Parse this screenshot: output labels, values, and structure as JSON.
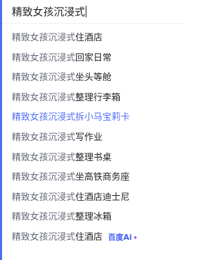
{
  "search": {
    "query": "精致女孩沉浸式"
  },
  "suggestions": [
    {
      "prefix": "精致女孩沉浸式",
      "suffix": "住酒店"
    },
    {
      "prefix": "精致女孩沉浸式",
      "suffix": "回家日常"
    },
    {
      "prefix": "精致女孩沉浸式",
      "suffix": "坐头等舱"
    },
    {
      "prefix": "精致女孩沉浸式",
      "suffix": "整理行李箱"
    },
    {
      "prefix": "精致女孩沉浸式",
      "suffix": "拆小马宝莉卡"
    },
    {
      "prefix": "精致女孩沉浸式",
      "suffix": "写作业"
    },
    {
      "prefix": "精致女孩沉浸式",
      "suffix": "整理书桌"
    },
    {
      "prefix": "精致女孩沉浸式",
      "suffix": "坐高铁商务座"
    },
    {
      "prefix": "精致女孩沉浸式",
      "suffix": "住酒店迪士尼"
    },
    {
      "prefix": "精致女孩沉浸式",
      "suffix": "整理冰箱"
    },
    {
      "prefix": "精致女孩沉浸式",
      "suffix": "住酒店"
    }
  ],
  "highlighted_index": 4,
  "ai_badge": {
    "text": "百度Ai",
    "spark": "✦"
  },
  "colors": {
    "accent": "#4e6ef2",
    "text": "#222222",
    "muted": "#626675"
  }
}
